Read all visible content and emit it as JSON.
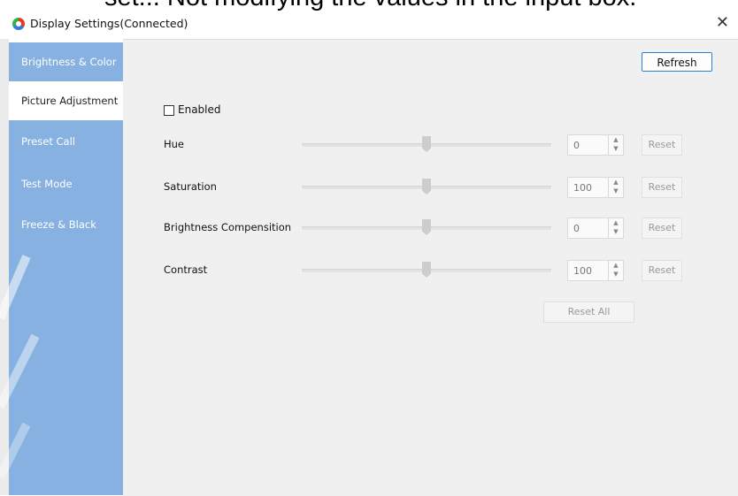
{
  "caption_fragment": "set... Not modifying the values in the input box.",
  "window": {
    "title": "Display Settings(Connected)",
    "close_glyph": "✕"
  },
  "sidebar": {
    "items": [
      {
        "label": "Brightness & Color",
        "active": false
      },
      {
        "label": "Picture Adjustment",
        "active": true
      },
      {
        "label": "Preset Call",
        "active": false
      },
      {
        "label": "Test Mode",
        "active": false
      },
      {
        "label": "Freeze & Black",
        "active": false
      }
    ]
  },
  "toolbar": {
    "refresh_label": "Refresh"
  },
  "enabled": {
    "label": "Enabled",
    "checked": false
  },
  "adjustments": [
    {
      "label": "Hue",
      "value": "0",
      "reset_label": "Reset",
      "slider_fraction": 0.5
    },
    {
      "label": "Saturation",
      "value": "100",
      "reset_label": "Reset",
      "slider_fraction": 0.5
    },
    {
      "label": "Brightness Compensition",
      "value": "0",
      "reset_label": "Reset",
      "slider_fraction": 0.5
    },
    {
      "label": "Contrast",
      "value": "100",
      "reset_label": "Reset",
      "slider_fraction": 0.5
    }
  ],
  "reset_all_label": "Reset All",
  "colors": {
    "sidebar_bg": "#86b1e0",
    "content_bg": "#f0f0f0",
    "accent_border": "#2f7fd4"
  }
}
